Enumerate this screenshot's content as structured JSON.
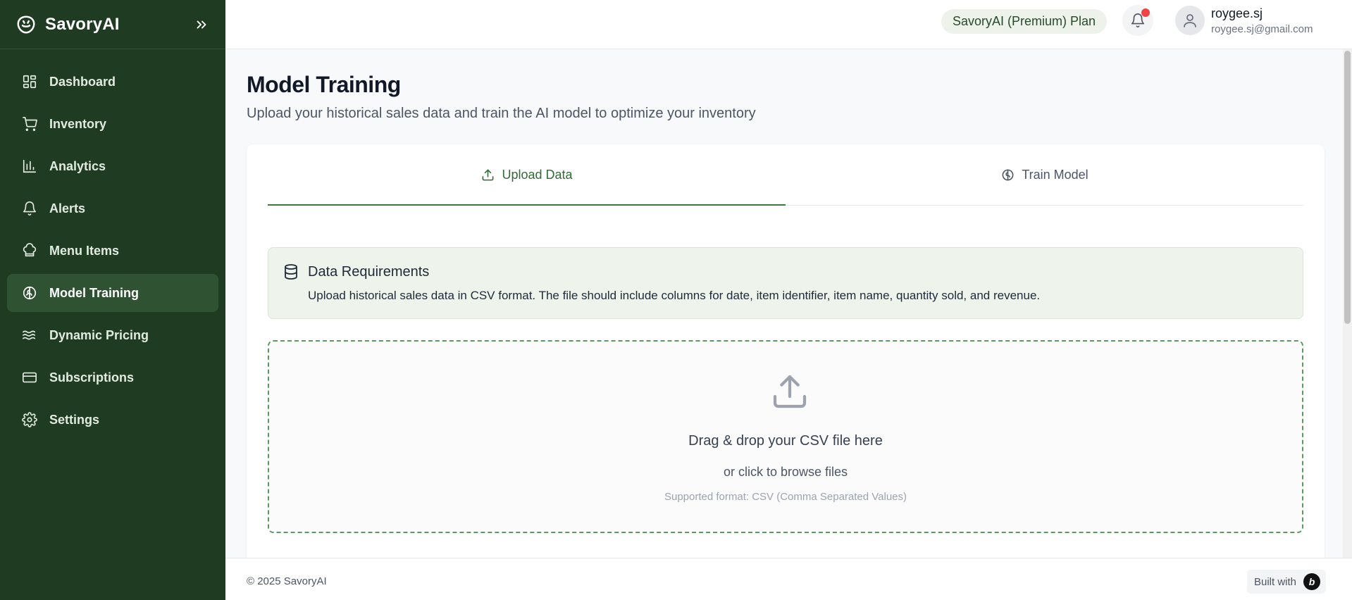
{
  "app": {
    "name": "SavoryAI"
  },
  "sidebar": {
    "items": [
      {
        "label": "Dashboard",
        "icon": "dashboard-icon"
      },
      {
        "label": "Inventory",
        "icon": "cart-icon"
      },
      {
        "label": "Analytics",
        "icon": "bar-chart-icon"
      },
      {
        "label": "Alerts",
        "icon": "bell-icon"
      },
      {
        "label": "Menu Items",
        "icon": "chef-hat-icon"
      },
      {
        "label": "Model Training",
        "icon": "brain-icon",
        "active": true
      },
      {
        "label": "Dynamic Pricing",
        "icon": "waves-icon"
      },
      {
        "label": "Subscriptions",
        "icon": "credit-card-icon"
      },
      {
        "label": "Settings",
        "icon": "gear-icon"
      }
    ]
  },
  "header": {
    "plan": "SavoryAI (Premium) Plan",
    "user": {
      "name": "roygee.sj",
      "email": "roygee.sj@gmail.com"
    }
  },
  "page": {
    "title": "Model Training",
    "subtitle": "Upload your historical sales data and train the AI model to optimize your inventory"
  },
  "tabs": [
    {
      "label": "Upload Data",
      "active": true
    },
    {
      "label": "Train Model",
      "active": false
    }
  ],
  "requirements": {
    "title": "Data Requirements",
    "text": "Upload historical sales data in CSV format. The file should include columns for date, item identifier, item name, quantity sold, and revenue."
  },
  "dropzone": {
    "title": "Drag & drop your CSV file here",
    "subtitle": "or click to browse files",
    "format": "Supported format: CSV (Comma Separated Values)"
  },
  "footer": {
    "copyright": "© 2025 SavoryAI",
    "built_with": "Built with"
  },
  "colors": {
    "sidebar_bg": "#1f3b22",
    "sidebar_active": "#2f5233",
    "accent": "#2f6b33",
    "notification": "#ef4444"
  }
}
